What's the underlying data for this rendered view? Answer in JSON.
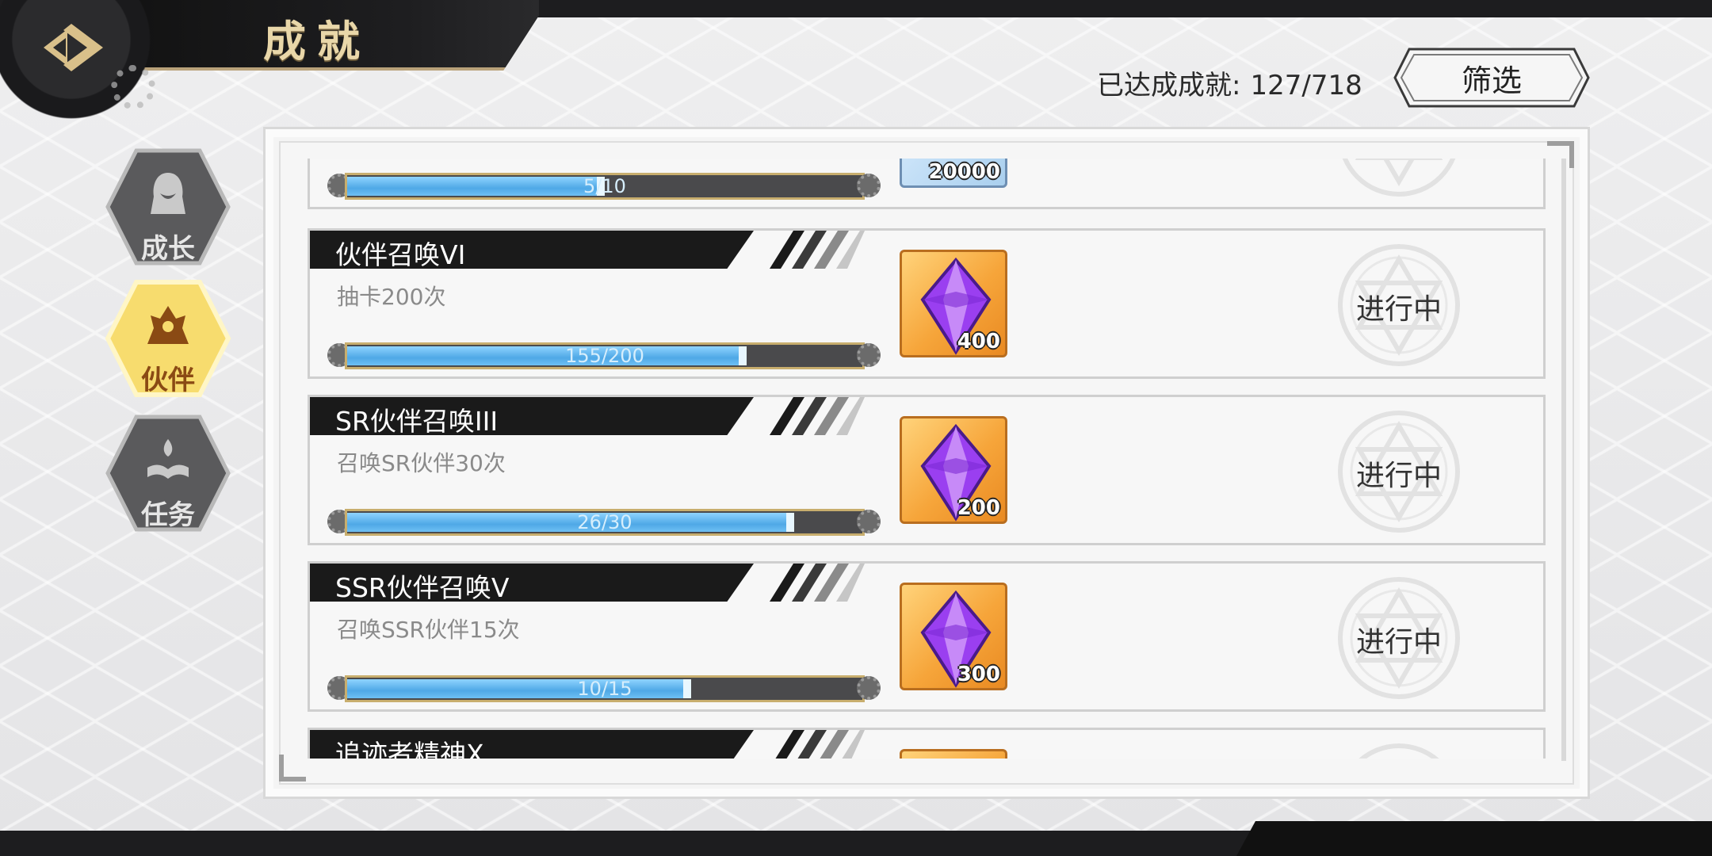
{
  "header": {
    "title": "成就",
    "achieved_label": "已达成成就:",
    "achieved_value": "127/718",
    "filter_label": "筛选"
  },
  "side_tabs": [
    {
      "label": "成长",
      "active": false,
      "icon": "hooded-figure-icon"
    },
    {
      "label": "伙伴",
      "active": true,
      "icon": "companion-group-icon"
    },
    {
      "label": "任务",
      "active": false,
      "icon": "book-flame-icon"
    }
  ],
  "achievements": [
    {
      "title": "",
      "desc": "",
      "progress_text": "5/10",
      "progress": 0.5,
      "reward_qty": "20000",
      "reward_type": "gold-coin-icon",
      "status": "",
      "partial": "top"
    },
    {
      "title": "伙伴召唤VI",
      "desc": "抽卡200次",
      "progress_text": "155/200",
      "progress": 0.775,
      "reward_qty": "400",
      "reward_type": "purple-crystal-icon",
      "status": "进行中"
    },
    {
      "title": "SR伙伴召唤III",
      "desc": "召唤SR伙伴30次",
      "progress_text": "26/30",
      "progress": 0.867,
      "reward_qty": "200",
      "reward_type": "purple-crystal-icon",
      "status": "进行中"
    },
    {
      "title": "SSR伙伴召唤V",
      "desc": "召唤SSR伙伴15次",
      "progress_text": "10/15",
      "progress": 0.667,
      "reward_qty": "300",
      "reward_type": "purple-crystal-icon",
      "status": "进行中"
    },
    {
      "title": "追迹者精神X",
      "desc": "",
      "progress_text": "",
      "progress": 0,
      "reward_qty": "",
      "reward_type": "purple-crystal-icon",
      "status": "",
      "partial": "bottom"
    }
  ],
  "colors": {
    "gold_accent": "#e9d7a9",
    "progress_fill": "#4fa8e6",
    "active_tab": "#f6d86a"
  }
}
